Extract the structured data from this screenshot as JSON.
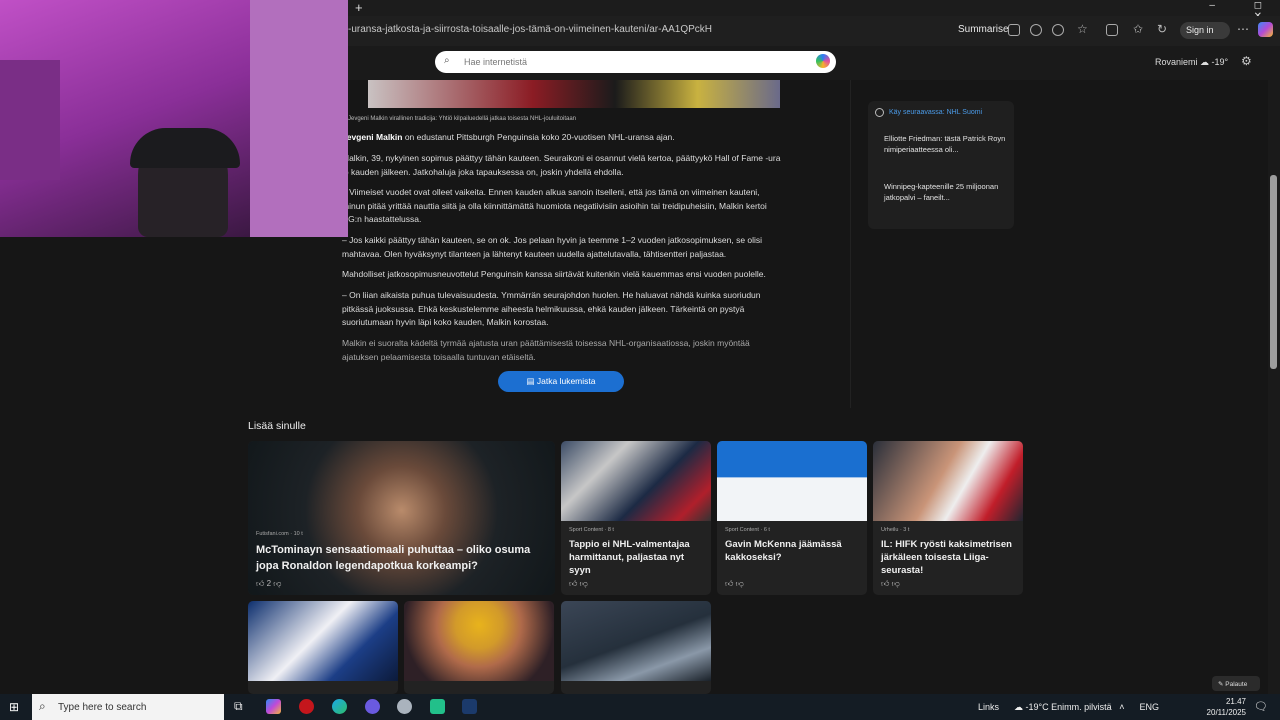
{
  "browser": {
    "url": "-uransa-jatkosta-ja-siirrosta-toisaalle-jos-tämä-on-viimeinen-kauteni/ar-AA1QPckH",
    "summarise_label": "Summarise",
    "signin_label": "Sign in",
    "new_tab": "+",
    "window_controls": "–  ◻  ✕"
  },
  "msn": {
    "search_placeholder": "Hae internetistä",
    "weather": "Rovaniemi ☁ -19°"
  },
  "article": {
    "caption": "Jevgeni Malkin virallinen tradicija: Yhtiö kilpailuedellä jatkaa toisesta NHL-jouluitoitaan",
    "p1_name": "Jevgeni Malkin",
    "p1_rest": " on edustanut Pittsburgh Penguinsia koko 20-vuotisen NHL-uransa ajan.",
    "p2": "Malkin, 39, nykyinen sopimus päättyy tähän kauteen. Seuraikoni ei osannut vielä kertoa, päättyykö Hall of Fame -ura jo kauden jälkeen. Jatkohaluja joka tapauksessa on, joskin yhdellä ehdolla.",
    "p3": "– Viimeiset vuodet ovat olleet vaikeita. Ennen kauden alkua sanoin itselleni, että jos tämä on viimeinen kauteni, minun pitää yrittää nauttia siitä ja olla kiinnittämättä huomiota negatiivisiin asioihin tai treidipuheisiin, Malkin kertoi RG:n haastattelussa.",
    "p4": "– Jos kaikki päättyy tähän kauteen, se on ok. Jos pelaan hyvin ja teemme 1–2 vuoden jatkosopimuksen, se olisi mahtavaa. Olen hyväksynyt tilanteen ja lähtenyt kauteen uudella ajattelutavalla, tähtisentteri paljastaa.",
    "p5": "Mahdolliset jatkosopimusneuvottelut Penguinsin kanssa siirtävät kuitenkin vielä kauemmas ensi vuoden puolelle.",
    "p6": "– On liian aikaista puhua tulevaisuudesta. Ymmärrän seurajohdon huolen. He haluavat nähdä kuinka suoriudun pitkässä juoksussa. Ehkä keskustelemme aiheesta helmikuussa, ehkä kauden jälkeen. Tärkeintä on pystyä suoriutumaan hyvin läpi koko kauden, Malkin korostaa.",
    "p7": "Malkin ei suoralta kädeltä tyrmää ajatusta uran päättämisestä toisessa NHL-organisaatiossa, joskin myöntää ajatuksen pelaamisesta toisaalla tuntuvan etäiseltä.",
    "continue_label": "Jatka lukemista"
  },
  "sidebar": {
    "follow_label": "Käy seuraavassa: NHL Suomi",
    "items": [
      "Elliotte Friedman: tästä Patrick Royn nimiperiaatteessa oli...",
      "Winnipeg-kapteenille 25 miljoonan jatkopalvi – faneilt..."
    ]
  },
  "feed": {
    "heading": "Lisää sinulle",
    "cards": [
      {
        "source": "Futisfani.com · 10 t",
        "title": "McTominayn sensaatiomaali puhuttaa – oliko osuma jopa Ronaldon legendapotkua korkeampi?",
        "likes": "2"
      },
      {
        "source": "Sport Content · 8 t",
        "title": "Tappio ei NHL-valmentajaa harmittanut, paljastaa nyt syyn",
        "likes": ""
      },
      {
        "source": "Sport Content · 6 t",
        "title": "Gavin McKenna jäämässä kakkoseksi?",
        "likes": ""
      },
      {
        "source": "Urheilu · 3 t",
        "title": "IL: HIFK ryösti kaksimetrisen järkäleen toisesta Liiga-seurasta!",
        "likes": ""
      }
    ]
  },
  "feedback_label": "Palaute",
  "taskbar": {
    "search_placeholder": "Type here to search",
    "links": "Links",
    "weather": "-19°C  Enimm. pilvistä",
    "lang": "ENG",
    "time": "21.47",
    "date": "20/11/2025"
  },
  "colors": {
    "accent": "#1c6fd1",
    "link": "#4b9be8"
  }
}
